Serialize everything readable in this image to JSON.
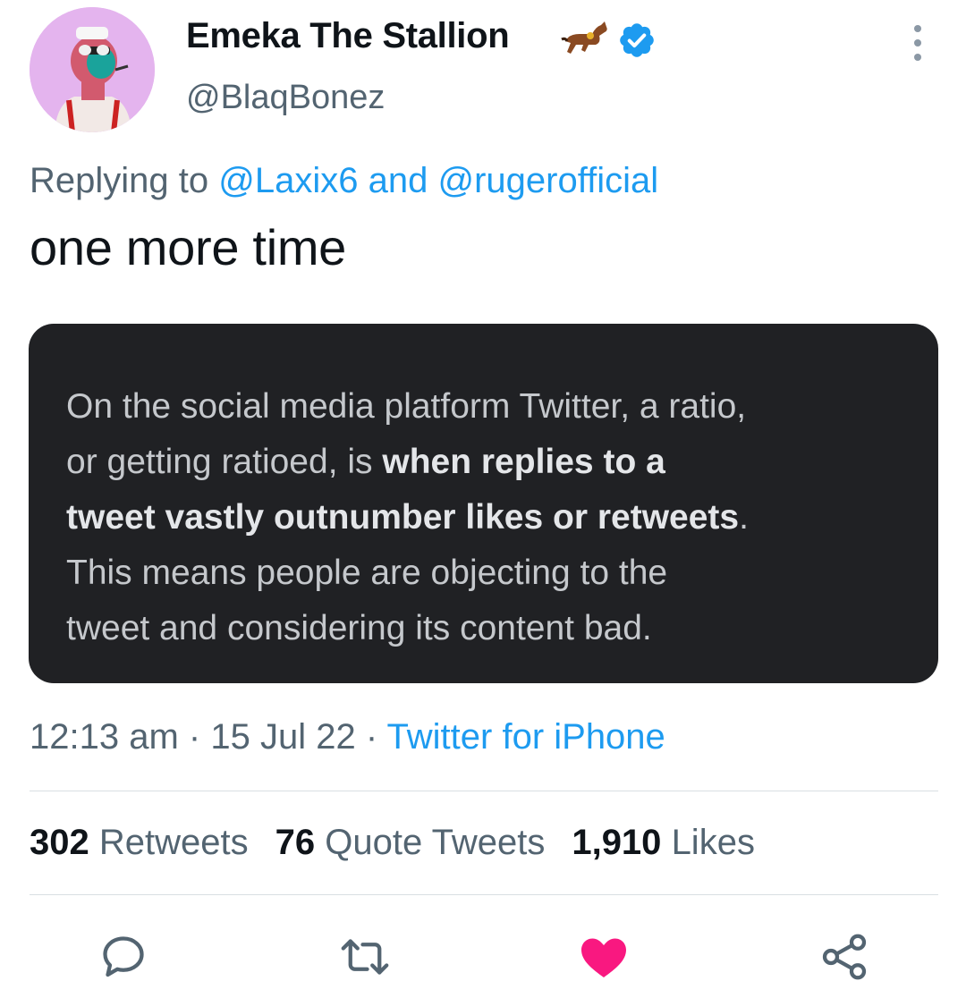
{
  "author": {
    "display_name": "Emeka The Stallion",
    "handle": "@BlaqBonez",
    "badge_emoji": "horse-racing-emoji",
    "verified": true
  },
  "reply": {
    "prefix": "Replying to",
    "mention_1": "@Laxix6",
    "conjunction": "and",
    "mention_2": "@rugerofficial"
  },
  "tweet": {
    "text": "one more time"
  },
  "media_card": {
    "line_1": "On the social media platform Twitter, a ratio,",
    "line_2_plain": "or getting ratioed, is ",
    "line_2_bold": "when replies to a",
    "line_3_bold": "tweet vastly outnumber likes or retweets",
    "line_3_end": ".",
    "line_4": "This means people are objecting to the",
    "line_5": "tweet and considering its content bad."
  },
  "meta": {
    "time": "12:13 am",
    "separator": "·",
    "date": "15 Jul 22",
    "source": "Twitter for iPhone"
  },
  "stats": {
    "retweets_count": "302",
    "retweets_label": "Retweets",
    "quotes_count": "76",
    "quotes_label": "Quote Tweets",
    "likes_count": "1,910",
    "likes_label": "Likes"
  },
  "actions": {
    "reply_icon": "reply-icon",
    "retweet_icon": "retweet-icon",
    "like_icon": "heart-icon",
    "share_icon": "share-icon",
    "like_active": true
  },
  "colors": {
    "link": "#1d9bf0",
    "secondary_text": "#536471",
    "like": "#f91880",
    "card_bg": "#202124"
  }
}
